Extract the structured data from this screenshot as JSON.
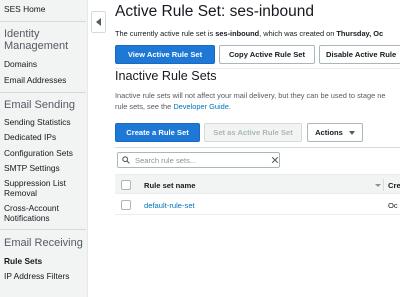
{
  "sidebar": {
    "home": "SES Home",
    "identity_title": "Identity Management",
    "identity_items": [
      "Domains",
      "Email Addresses"
    ],
    "sending_title": "Email Sending",
    "sending_items": [
      "Sending Statistics",
      "Dedicated IPs",
      "Configuration Sets",
      "SMTP Settings",
      "Suppression List Removal",
      "Cross-Account Notifications"
    ],
    "receiving_title": "Email Receiving",
    "receiving_items": [
      "Rule Sets",
      "IP Address Filters"
    ],
    "active_item": "Rule Sets"
  },
  "main": {
    "title": "Active Rule Set: ses-inbound",
    "info_prefix": "The currently active rule set is ",
    "info_ruleset": "ses-inbound",
    "info_mid": ", which was created on ",
    "info_date": "Thursday, Oc",
    "buttons": {
      "view_active": "View Active Rule Set",
      "copy_active": "Copy Active Rule Set",
      "disable_active": "Disable Active Rule"
    },
    "inactive_title": "Inactive Rule Sets",
    "inactive_desc_line1": "Inactive rule sets will not affect your mail delivery, but they can be used to stage ne",
    "inactive_desc_line2_prefix": "rule sets, see the ",
    "inactive_desc_link": "Developer Guide",
    "inactive_desc_line2_suffix": ".",
    "toolbar": {
      "create": "Create a Rule Set",
      "set_active": "Set as Active Rule Set",
      "actions": "Actions"
    },
    "search": {
      "placeholder": "Search rule sets..."
    },
    "table": {
      "columns": [
        "Rule set name",
        "Cre"
      ],
      "rows": [
        {
          "name": "default-rule-set",
          "created": "Oc"
        }
      ]
    }
  },
  "colors": {
    "primary": "#1e78d6",
    "link": "#0073bb",
    "sidebar_bg": "#f2f3f3"
  }
}
